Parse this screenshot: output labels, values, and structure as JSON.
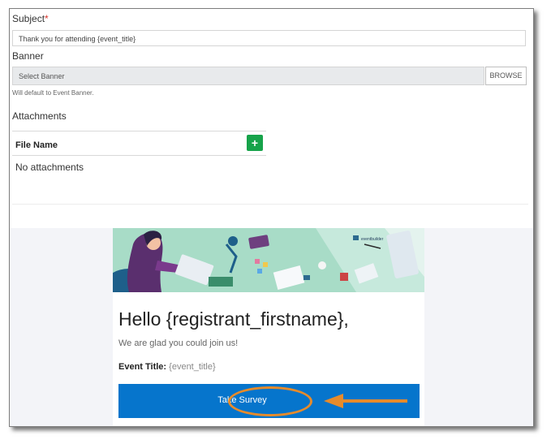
{
  "form": {
    "subject_label": "Subject",
    "required_mark": "*",
    "subject_value": "Thank you for attending {event_title}",
    "banner_label": "Banner",
    "banner_placeholder": "Select Banner",
    "browse_label": "BROWSE",
    "banner_hint": "Will default to Event Banner.",
    "attachments_label": "Attachments",
    "file_name_header": "File Name",
    "add_icon": "+",
    "no_attachments": "No attachments"
  },
  "preview": {
    "brand_text": "eventbuilder",
    "greeting": "Hello {registrant_firstname},",
    "subtext": "We are glad you could join us!",
    "event_title_label": "Event Title:",
    "event_title_value": "{event_title}",
    "survey_button": "Take Survey"
  },
  "colors": {
    "accent_blue": "#0675cc",
    "add_green": "#17a34a",
    "callout_orange": "#e68b2b",
    "required_red": "#d9342b"
  }
}
